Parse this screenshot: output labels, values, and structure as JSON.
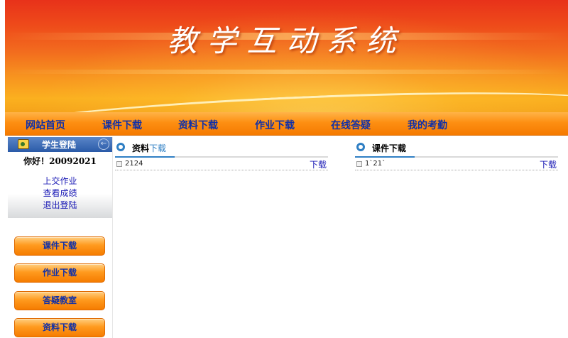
{
  "banner": {
    "title": "教学互动系统"
  },
  "nav": {
    "items": [
      {
        "label": "网站首页"
      },
      {
        "label": "课件下载"
      },
      {
        "label": "资料下载"
      },
      {
        "label": "作业下载"
      },
      {
        "label": "在线答疑"
      },
      {
        "label": "我的考勤"
      }
    ]
  },
  "login": {
    "title": "学生登陆",
    "greeting": "你好！20092021",
    "links": [
      {
        "label": "上交作业"
      },
      {
        "label": "查看成绩"
      },
      {
        "label": "退出登陆"
      }
    ]
  },
  "sidebar_buttons": [
    {
      "label": "课件下载"
    },
    {
      "label": "作业下载"
    },
    {
      "label": "答疑教室"
    },
    {
      "label": "资料下载"
    }
  ],
  "panels": {
    "materials": {
      "title_main": "资料",
      "title_accent": "下载",
      "rows": [
        {
          "name": "2124",
          "action": "下载"
        }
      ]
    },
    "courseware": {
      "title_main": "课件下载",
      "rows": [
        {
          "name": "1`21`",
          "action": "下载"
        }
      ]
    }
  },
  "colors": {
    "nav_text": "#1030a8",
    "link": "#1a1ab5",
    "accent_blue": "#2f7fc4",
    "nav_orange": "#fd8f12"
  }
}
